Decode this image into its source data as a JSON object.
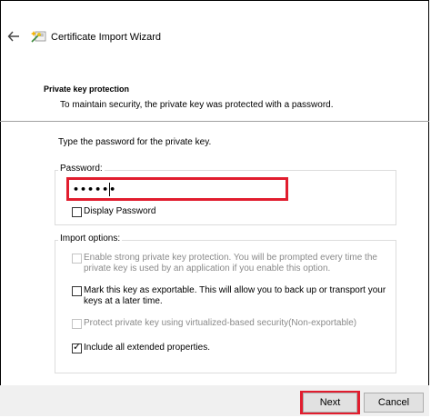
{
  "window": {
    "title": "Certificate Import Wizard",
    "back_icon": "back-arrow-icon",
    "title_icon": "certificate-wizard-icon"
  },
  "header": {
    "heading": "Private key protection",
    "subheading": "To maintain security, the private key was protected with a password."
  },
  "instruction": "Type the password for the private key.",
  "password_group": {
    "label": "Password:",
    "value": "••••••",
    "display_password_label": "Display Password",
    "display_password_checked": false
  },
  "import_options": {
    "label": "Import options:",
    "options": [
      {
        "text": "Enable strong private key protection. You will be prompted every time the private key is used by an application if you enable this option.",
        "checked": false,
        "enabled": false
      },
      {
        "text": "Mark this key as exportable. This will allow you to back up or transport your keys at a later time.",
        "checked": false,
        "enabled": true
      },
      {
        "text": "Protect private key using virtualized-based security(Non-exportable)",
        "checked": false,
        "enabled": false
      },
      {
        "text": "Include all extended properties.",
        "checked": true,
        "enabled": true
      }
    ]
  },
  "footer": {
    "next_label": "Next",
    "cancel_label": "Cancel"
  },
  "colors": {
    "highlight": "#e11d2e"
  }
}
